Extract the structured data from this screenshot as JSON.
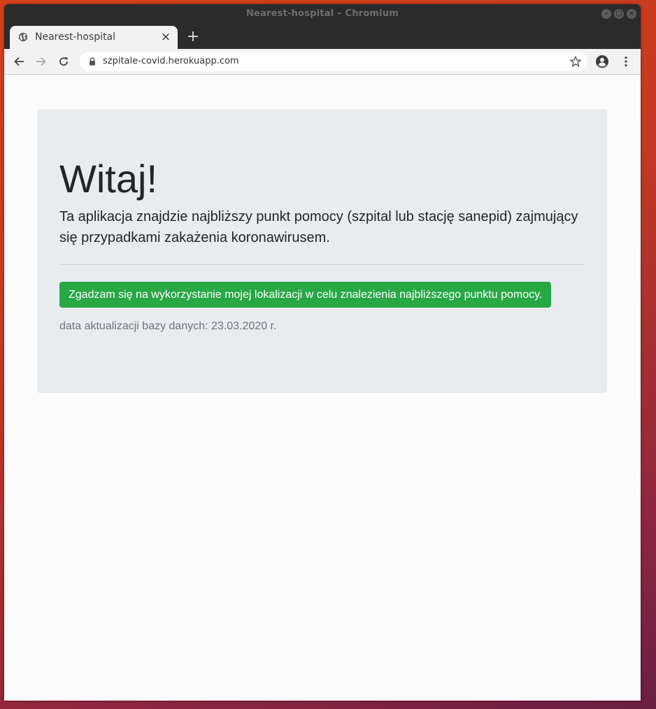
{
  "window": {
    "title": "Nearest-hospital – Chromium",
    "controls": {
      "minimize": "–",
      "maximize": "□",
      "close": "×"
    }
  },
  "tab": {
    "title": "Nearest-hospital",
    "close_label": "×",
    "new_tab_label": "+"
  },
  "toolbar": {
    "url": "szpitale-covid.herokuapp.com"
  },
  "page": {
    "heading": "Witaj!",
    "lead": "Ta aplikacja znajdzie najbliższy punkt pomocy (szpital lub stację sanepid) zajmujący się przypadkami zakażenia koronawirusem.",
    "consent_button": "Zgadzam się na wykorzystanie mojej lokalizacji w celu znalezienia najbliższego punktu pomocy.",
    "update_info": "data aktualizacji bazy danych: 23.03.2020 r."
  },
  "icons": {
    "tab_favicon": "globe-icon",
    "back": "arrow-left-icon",
    "forward": "arrow-right-icon",
    "reload": "reload-icon",
    "secure": "lock-icon",
    "bookmark": "star-icon",
    "profile": "account-icon",
    "menu": "kebab-menu-icon"
  },
  "colors": {
    "button_green": "#28a745",
    "jumbotron_bg": "#e9ecef",
    "muted_text": "#6c757d"
  }
}
